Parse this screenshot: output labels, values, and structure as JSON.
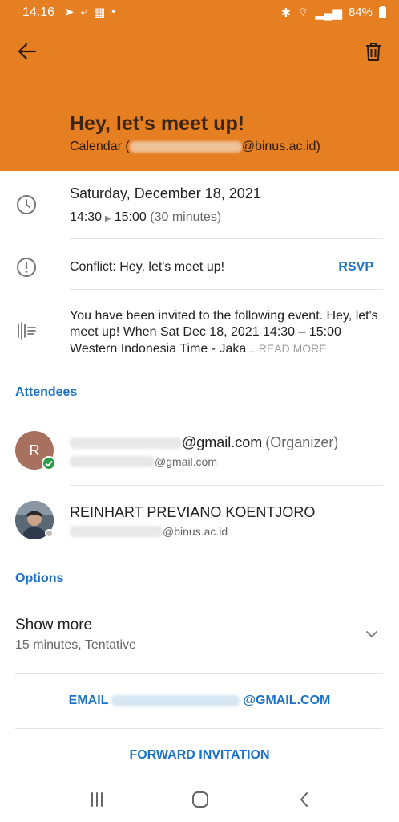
{
  "status_bar": {
    "time": "14:16",
    "battery": "84%"
  },
  "header": {
    "title": "Hey, let's meet up!",
    "calendar_prefix": "Calendar (",
    "calendar_suffix": "@binus.ac.id)",
    "color": "#e67e22"
  },
  "event": {
    "date": "Saturday, December 18, 2021",
    "start": "14:30",
    "end": "15:00",
    "duration": "(30 minutes)",
    "conflict": "Conflict: Hey, let's meet up!",
    "rsvp_label": "RSVP",
    "description": "You have been invited to the following event.   Hey, let's meet up!   When  Sat Dec 18, 2021 14:30 – 15:00 Western Indonesia Time - Jaka",
    "read_more": "... READ MORE"
  },
  "attendees": {
    "label": "Attendees",
    "items": [
      {
        "initial": "R",
        "primary_suffix": "@gmail.com",
        "role": "(Organizer)",
        "secondary_suffix": "@gmail.com"
      },
      {
        "name": "REINHART PREVIANO KOENTJORO",
        "secondary_suffix": "@binus.ac.id"
      }
    ]
  },
  "options": {
    "label": "Options",
    "show_more": "Show more",
    "summary": "15 minutes, Tentative"
  },
  "actions": {
    "email_prefix": "EMAIL",
    "email_suffix": "@GMAIL.COM",
    "forward": "FORWARD INVITATION"
  },
  "accent_color": "#1a73c8"
}
